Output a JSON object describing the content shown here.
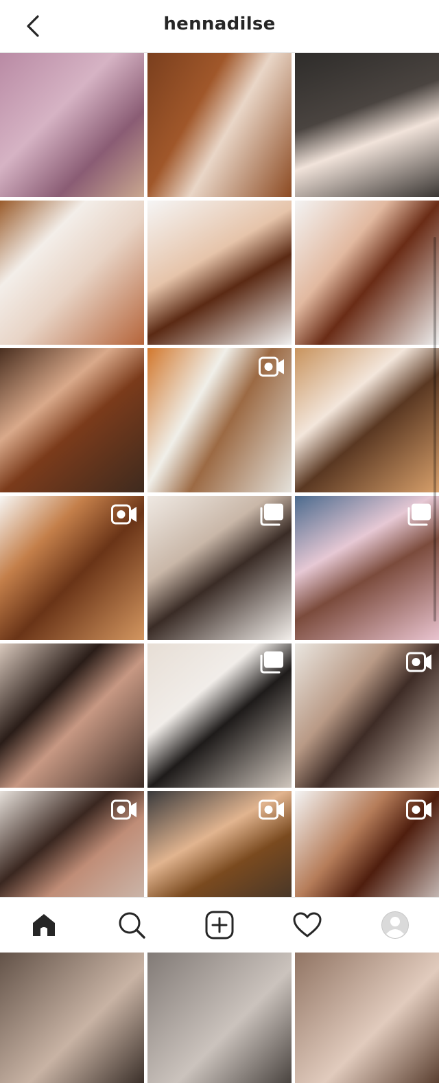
{
  "header": {
    "title": "hennadilse",
    "back_icon": "chevron-left-icon"
  },
  "colors": {
    "text": "#262626",
    "divider": "#dbdbdb",
    "background": "#ffffff"
  },
  "grid": {
    "tiles": [
      {
        "name": "post-bridal-portrait",
        "bg": "linear-gradient(135deg,#b98aa4 0%,#d6b3c4 40%,#8a5c74 70%,#c9a78f 100%)",
        "badge": "none"
      },
      {
        "name": "post-henna-hand-wood",
        "bg": "linear-gradient(120deg,#7a3f1e 0%,#a0572a 35%,#e9d6c7 55%,#8c4a22 100%)",
        "badge": "none"
      },
      {
        "name": "post-henna-hand-dark",
        "bg": "linear-gradient(160deg,#2e2c2a 0%,#4a4440 40%,#f1e3da 60%,#3a3633 100%)",
        "badge": "none"
      },
      {
        "name": "post-henna-arms-paper",
        "bg": "linear-gradient(135deg,#9a5c2c 0%,#f3eee9 30%,#e8d4c6 55%,#b5643a 100%)",
        "badge": "none"
      },
      {
        "name": "post-henna-hands-lattice",
        "bg": "linear-gradient(150deg,#f5f5f5 0%,#e6c4aa 40%,#5b2a14 60%,#f0f0f0 100%)",
        "badge": "none"
      },
      {
        "name": "post-henna-hands-floral",
        "bg": "linear-gradient(130deg,#f3f3f3 0%,#e2b9a0 35%,#6a2c16 55%,#efefef 100%)",
        "badge": "none"
      },
      {
        "name": "post-henna-palms-wood",
        "bg": "linear-gradient(140deg,#4a2f20 0%,#d9a98a 35%,#7b3b1b 55%,#3e2a1e 100%)",
        "badge": "none"
      },
      {
        "name": "post-henna-arm-video",
        "bg": "linear-gradient(120deg,#d2782e 0%,#f0efe9 35%,#9c6a44 55%,#e4e1da 100%)",
        "badge": "reel"
      },
      {
        "name": "post-henna-hands-crossed",
        "bg": "linear-gradient(140deg,#c8935d 0%,#f3e6db 35%,#5a3822 55%,#d8a06b 100%)",
        "badge": "none"
      },
      {
        "name": "post-henna-application-video",
        "bg": "linear-gradient(135deg,#f7f6f4 0%,#c47f4a 30%,#6a3417 55%,#d39660 100%)",
        "badge": "reel"
      },
      {
        "name": "post-family-portrait",
        "bg": "linear-gradient(145deg,#efe9e3 0%,#c9b7a8 35%,#3a2c26 55%,#f2eeea 100%)",
        "badge": "carousel"
      },
      {
        "name": "post-mother-daughter",
        "bg": "linear-gradient(150deg,#4b6a8d 0%,#e6c8d4 35%,#7b4b3c 55%,#e9c3cf 100%)",
        "badge": "carousel"
      },
      {
        "name": "post-selfie-portrait",
        "bg": "linear-gradient(135deg,#d8c8bc 0%,#2a1d18 35%,#c79883 55%,#3d2c25 100%)",
        "badge": "none"
      },
      {
        "name": "post-bedroom-play",
        "bg": "linear-gradient(140deg,#e7ded5 0%,#f1ede9 35%,#1e1b1a 55%,#cfc6bd 100%)",
        "badge": "carousel"
      },
      {
        "name": "post-baby-video",
        "bg": "linear-gradient(130deg,#eae6e0 0%,#b99a86 35%,#3e2c26 55%,#d9c9bd 100%)",
        "badge": "reel"
      },
      {
        "name": "post-face-video",
        "bg": "linear-gradient(140deg,#e5dfd9 0%,#3a2720 35%,#c08d77 55%,#cfc7bf 100%)",
        "badge": "reel"
      },
      {
        "name": "post-henna-hand-dark-video",
        "bg": "linear-gradient(150deg,#3a3a3c 0%,#e1b48f 35%,#7a4a1f 55%,#2c2c2e 100%)",
        "badge": "reel"
      },
      {
        "name": "post-henna-bridal-hands",
        "bg": "linear-gradient(130deg,#f4f4f4 0%,#b67d5a 35%,#4f1e0e 55%,#eeeeee 100%)",
        "badge": "reel"
      },
      {
        "name": "post-partial-1",
        "bg": "linear-gradient(135deg,#5a4a40 0%,#c8b3a4 60%,#3b302a 100%)",
        "badge": "none"
      },
      {
        "name": "post-partial-2",
        "bg": "linear-gradient(135deg,#7b7470 0%,#cbc3bd 60%,#4a4440 100%)",
        "badge": "none"
      },
      {
        "name": "post-partial-3",
        "bg": "linear-gradient(135deg,#8a6d5c 0%,#e1cbbd 60%,#5a3f30 100%)",
        "badge": "none"
      }
    ]
  },
  "bottom_nav": {
    "items": [
      {
        "name": "nav-home",
        "icon": "home-icon",
        "active": true
      },
      {
        "name": "nav-search",
        "icon": "search-icon",
        "active": false
      },
      {
        "name": "nav-create",
        "icon": "add-post-icon",
        "active": false
      },
      {
        "name": "nav-activity",
        "icon": "heart-icon",
        "active": false
      },
      {
        "name": "nav-profile",
        "icon": "avatar-icon",
        "active": false
      }
    ]
  }
}
